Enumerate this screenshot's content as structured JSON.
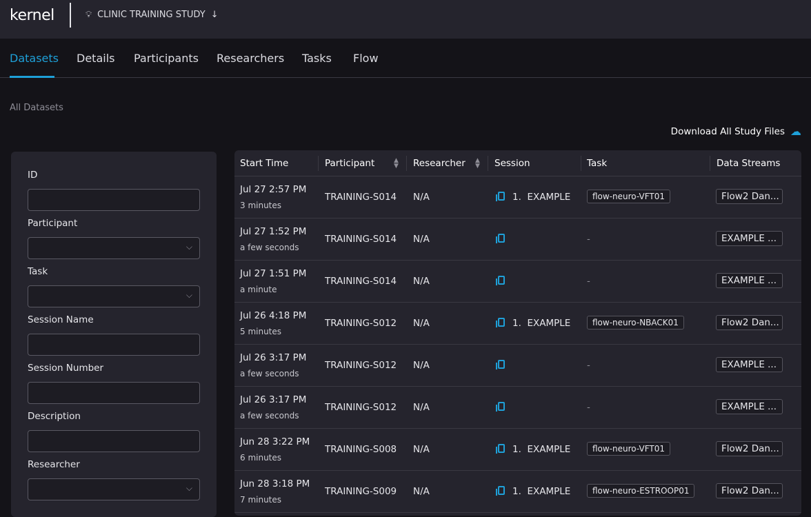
{
  "header": {
    "logo": "kernel",
    "study": "CLINIC TRAINING STUDY"
  },
  "tabs": [
    "Datasets",
    "Details",
    "Participants",
    "Researchers",
    "Tasks",
    "Flow"
  ],
  "breadcrumb": "All Datasets",
  "download_label": "Download All Study Files",
  "filters": [
    {
      "label": "ID",
      "type": "text"
    },
    {
      "label": "Participant",
      "type": "select"
    },
    {
      "label": "Task",
      "type": "select"
    },
    {
      "label": "Session Name",
      "type": "text"
    },
    {
      "label": "Session Number",
      "type": "text"
    },
    {
      "label": "Description",
      "type": "text"
    },
    {
      "label": "Researcher",
      "type": "select"
    }
  ],
  "table": {
    "columns": [
      "Start Time",
      "Participant",
      "Researcher",
      "Session",
      "Task",
      "Data Streams"
    ],
    "rows": [
      {
        "start": "Jul 27 2:57 PM",
        "ago": "3 minutes",
        "participant": "TRAINING-S014",
        "researcher": "N/A",
        "session": "1.  EXAMPLE",
        "task": "flow-neuro-VFT01",
        "stream": "Flow2 Dan..."
      },
      {
        "start": "Jul 27 1:52 PM",
        "ago": "a few seconds",
        "participant": "TRAINING-S014",
        "researcher": "N/A",
        "session": "",
        "task": "-",
        "stream": "EXAMPLE ..."
      },
      {
        "start": "Jul 27 1:51 PM",
        "ago": "a minute",
        "participant": "TRAINING-S014",
        "researcher": "N/A",
        "session": "",
        "task": "-",
        "stream": "EXAMPLE ..."
      },
      {
        "start": "Jul 26 4:18 PM",
        "ago": "5 minutes",
        "participant": "TRAINING-S012",
        "researcher": "N/A",
        "session": "1.  EXAMPLE",
        "task": "flow-neuro-NBACK01",
        "stream": "Flow2 Dan..."
      },
      {
        "start": "Jul 26 3:17 PM",
        "ago": "a few seconds",
        "participant": "TRAINING-S012",
        "researcher": "N/A",
        "session": "",
        "task": "-",
        "stream": "EXAMPLE ..."
      },
      {
        "start": "Jul 26 3:17 PM",
        "ago": "a few seconds",
        "participant": "TRAINING-S012",
        "researcher": "N/A",
        "session": "",
        "task": "-",
        "stream": "EXAMPLE ..."
      },
      {
        "start": "Jun 28 3:22 PM",
        "ago": "6 minutes",
        "participant": "TRAINING-S008",
        "researcher": "N/A",
        "session": "1.  EXAMPLE",
        "task": "flow-neuro-VFT01",
        "stream": "Flow2 Dan..."
      },
      {
        "start": "Jun 28 3:18 PM",
        "ago": "7 minutes",
        "participant": "TRAINING-S009",
        "researcher": "N/A",
        "session": "1.  EXAMPLE",
        "task": "flow-neuro-ESTROOP01",
        "stream": "Flow2 Dan..."
      }
    ]
  },
  "colors": {
    "accent": "#1ea0d8",
    "header_bg": "#25242d",
    "page_bg": "#141318"
  }
}
